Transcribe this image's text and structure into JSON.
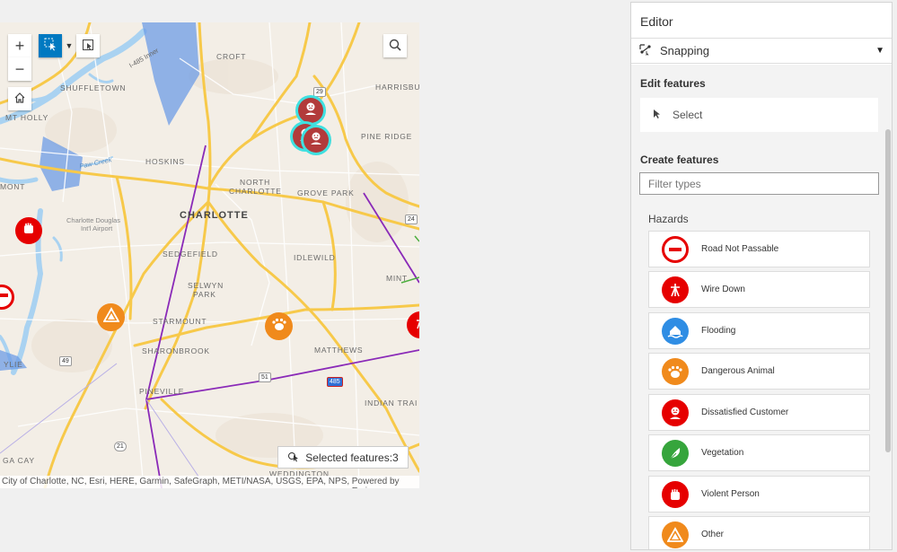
{
  "map": {
    "places": {
      "croft": "CROFT",
      "harrisburg": "HARRISBU",
      "shuffletown": "SHUFFLETOWN",
      "mt_holly": "MT HOLLY",
      "pine_ridge": "PINE RIDGE",
      "hoskins": "HOSKINS",
      "north_charlotte_1": "NORTH",
      "north_charlotte_2": "CHARLOTTE",
      "grove_park": "GROVE PARK",
      "mont": "MONT",
      "charlotte": "CHARLOTTE",
      "airport_1": "Charlotte Douglas",
      "airport_2": "Int'l Airport",
      "sedgefield": "SEDGEFIELD",
      "idlewild": "IDLEWILD",
      "mint": "MINT",
      "selwyn_1": "SELWYN",
      "selwyn_2": "PARK",
      "starmount": "STARMOUNT",
      "sharonbrook": "SHARONBROOK",
      "matthews": "MATTHEWS",
      "wylie": "YLIE",
      "pineville": "PINEVILLE",
      "indian_trail": "INDIAN TRAI",
      "paw_creek": "Paw Creek",
      "i485_inner": "I-485 Inner",
      "ga_cay": "GA CAY",
      "weddington": "WEDDINGTON"
    },
    "shields": {
      "r29": "29",
      "r24": "24",
      "r49": "49",
      "r51": "51",
      "i485": "485",
      "r21": "21"
    },
    "selected_features_label": "Selected features:3",
    "attribution_left": "City of Charlotte, NC, Esri, HERE, Garmin, SafeGraph, METI/NASA, USGS, EPA, NPS, ...",
    "attribution_right": "Powered by Esri"
  },
  "editor": {
    "title": "Editor",
    "snapping_label": "Snapping",
    "edit_features_title": "Edit features",
    "select_label": "Select",
    "create_features_title": "Create features",
    "filter_placeholder": "Filter types",
    "group_label": "Hazards",
    "hazards": [
      {
        "label": "Road Not Passable",
        "icon": "road-not-passable-icon",
        "color": "#e60000"
      },
      {
        "label": "Wire Down",
        "icon": "wire-down-icon",
        "color": "#e60000"
      },
      {
        "label": "Flooding",
        "icon": "flooding-icon",
        "color": "#2f8de4"
      },
      {
        "label": "Dangerous Animal",
        "icon": "dangerous-animal-icon",
        "color": "#f08a1c"
      },
      {
        "label": "Dissatisfied Customer",
        "icon": "dissatisfied-customer-icon",
        "color": "#e60000"
      },
      {
        "label": "Vegetation",
        "icon": "vegetation-icon",
        "color": "#36a53c"
      },
      {
        "label": "Violent Person",
        "icon": "violent-person-icon",
        "color": "#e60000"
      },
      {
        "label": "Other",
        "icon": "other-icon",
        "color": "#f08a1c"
      }
    ]
  },
  "colors": {
    "road": "#f7c94a",
    "water": "#a9d2f1",
    "polygon": "#6d9ce6",
    "route_line": "#8a2ab8",
    "selection_halo": "#3fe0e0",
    "select_tool_active": "#0079c1"
  }
}
